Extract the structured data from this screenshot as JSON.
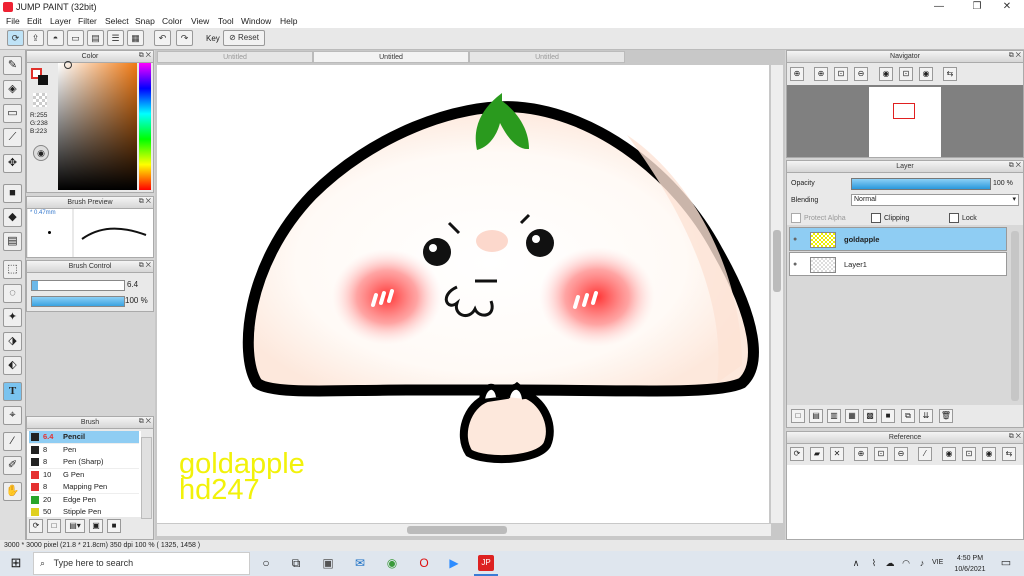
{
  "app": {
    "title": "JUMP PAINT (32bit)",
    "window_controls": [
      "—",
      "❐",
      "✕"
    ]
  },
  "menu": [
    "File",
    "Edit",
    "Layer",
    "Filter",
    "Select",
    "Snap",
    "Color",
    "View",
    "Tool",
    "Window",
    "Help"
  ],
  "toolbar": {
    "key_label": "Key",
    "reset_label": "Reset"
  },
  "color_panel": {
    "title": "Color",
    "r": "R:255",
    "g": "G:238",
    "b": "B:223",
    "fg_color": "#ffeedf",
    "accent": "#e0302a"
  },
  "brush_preview": {
    "title": "Brush Preview",
    "size_label": "* 0.47mm"
  },
  "brush_control": {
    "title": "Brush Control",
    "size_value": "6.4",
    "opacity_value": "100 %",
    "size_fraction": 0.07,
    "opacity_fraction": 1.0
  },
  "brush_list": {
    "title": "Brush",
    "items": [
      {
        "size": "6.4",
        "name": "Pencil",
        "color": "#222222",
        "selected": true
      },
      {
        "size": "8",
        "name": "Pen",
        "color": "#222222",
        "selected": false
      },
      {
        "size": "8",
        "name": "Pen (Sharp)",
        "color": "#222222",
        "selected": false
      },
      {
        "size": "10",
        "name": "G Pen",
        "color": "#e53030",
        "selected": false
      },
      {
        "size": "8",
        "name": "Mapping Pen",
        "color": "#e53030",
        "selected": false
      },
      {
        "size": "20",
        "name": "Edge Pen",
        "color": "#2aa52a",
        "selected": false
      },
      {
        "size": "50",
        "name": "Stipple Pen",
        "color": "#e0d020",
        "selected": false
      }
    ]
  },
  "tabs": [
    "Untitled",
    "Untitled",
    "Untitled"
  ],
  "active_tab": 1,
  "watermark": {
    "line1": "goldapple",
    "line2": "hd247",
    "color": "#f2f20a"
  },
  "navigator": {
    "title": "Navigator"
  },
  "layer_panel": {
    "title": "Layer",
    "opacity_label": "Opacity",
    "opacity_value": "100 %",
    "blending_label": "Blending",
    "blending_value": "Normal",
    "protect_alpha": "Protect Alpha",
    "clipping": "Clipping",
    "lock": "Lock",
    "layers": [
      {
        "name": "goldapple",
        "selected": true
      },
      {
        "name": "Layer1",
        "selected": false
      }
    ]
  },
  "reference": {
    "title": "Reference"
  },
  "status": {
    "text": "3000 * 3000 pixel   (21.8 * 21.8cm)   350 dpi   100 %   ( 1325, 1458 )"
  },
  "taskbar": {
    "search_placeholder": "Type here to search",
    "time": "4:50 PM",
    "date": "10/6/2021",
    "lang": "VIE"
  }
}
